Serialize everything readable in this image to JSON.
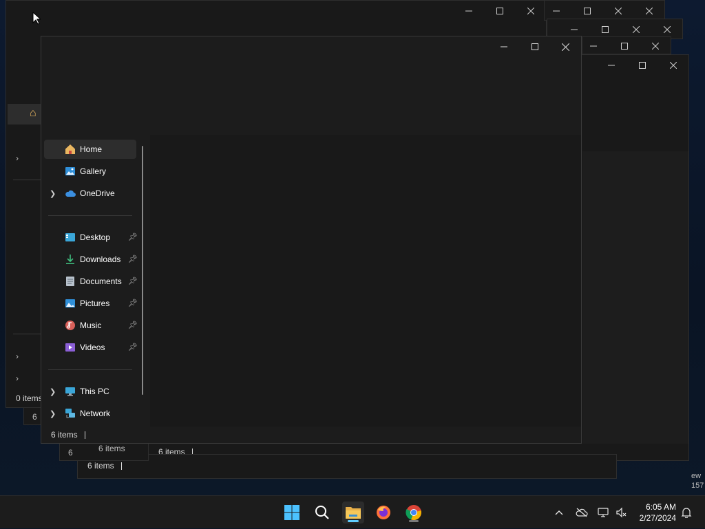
{
  "status": {
    "main_items": "6 items",
    "win_a_items": "0 items",
    "win_b_items": "6 items",
    "win_c_items": "6 items",
    "win_d_items": "6 items",
    "win_e_items": "6 items",
    "win_f_items": "6"
  },
  "edge_text": {
    "line1": "ew",
    "line2": "157"
  },
  "nav": {
    "home": "Home",
    "gallery": "Gallery",
    "onedrive": "OneDrive",
    "desktop": "Desktop",
    "downloads": "Downloads",
    "documents": "Documents",
    "pictures": "Pictures",
    "music": "Music",
    "videos": "Videos",
    "this_pc": "This PC",
    "network": "Network"
  },
  "icons": {
    "home": "home-icon",
    "gallery": "gallery-icon",
    "onedrive": "cloud-icon",
    "desktop": "desktop-icon",
    "downloads": "download-icon",
    "documents": "document-icon",
    "pictures": "picture-icon",
    "music": "music-icon",
    "videos": "video-icon",
    "this_pc": "monitor-icon",
    "network": "network-icon",
    "pin": "pin-icon"
  },
  "taskbar": {
    "time": "6:05 AM",
    "date": "2/27/2024",
    "apps": [
      "start",
      "search",
      "file-explorer",
      "firefox",
      "chrome"
    ]
  },
  "colors": {
    "accent": "#60cdff",
    "window_bg": "#1c1c1c",
    "taskbar_bg": "#1c1c1c"
  }
}
